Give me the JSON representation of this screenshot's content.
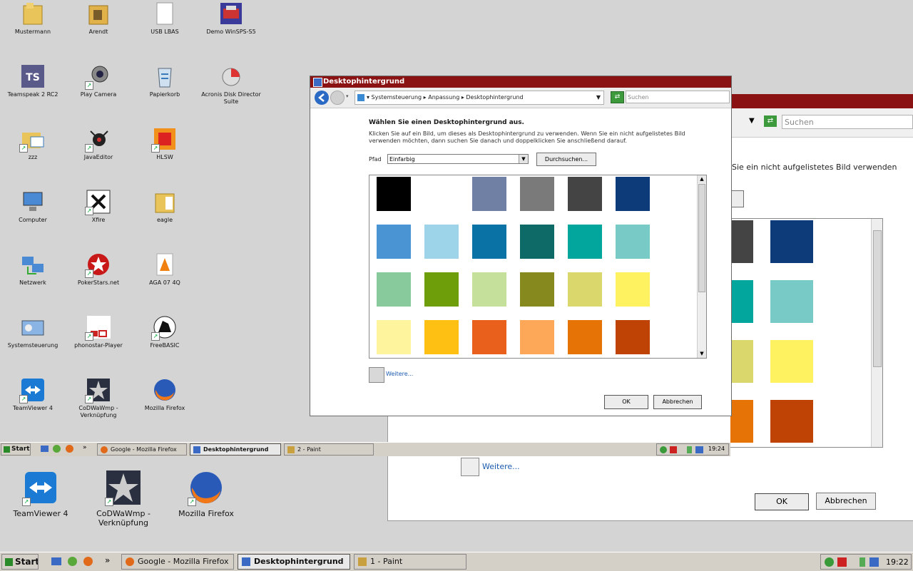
{
  "desktop_small": {
    "icons": [
      {
        "label": "Mustermann"
      },
      {
        "label": "Arendt"
      },
      {
        "label": "USB LBAS"
      },
      {
        "label": "Demo WinSPS-S5"
      },
      {
        "label": "Teamspeak 2 RC2"
      },
      {
        "label": "Play Camera"
      },
      {
        "label": "Papierkorb"
      },
      {
        "label": "Acronis Disk Director Suite"
      },
      {
        "label": "zzz"
      },
      {
        "label": "JavaEditor"
      },
      {
        "label": "HLSW"
      },
      {
        "label": "Computer"
      },
      {
        "label": "Xfire"
      },
      {
        "label": "eagle"
      },
      {
        "label": "Netzwerk"
      },
      {
        "label": "PokerStars.net"
      },
      {
        "label": "AGA 07 4Q"
      },
      {
        "label": "Systemsteuerung"
      },
      {
        "label": "phonostar-Player"
      },
      {
        "label": "FreeBASIC"
      },
      {
        "label": "TeamViewer 4"
      },
      {
        "label": "CoDWaWmp - Verknüpfung"
      },
      {
        "label": "Mozilla Firefox"
      }
    ]
  },
  "desktop_large": {
    "icons": [
      {
        "label": "TeamViewer 4"
      },
      {
        "label": "CoDWaWmp - Verknüpfung"
      },
      {
        "label": "Mozilla Firefox"
      }
    ]
  },
  "window": {
    "title": "Desktophintergrund",
    "breadcrumb": "▾ Systemsteuerung ▸ Anpassung ▸ Desktophintergrund",
    "search_placeholder": "Suchen",
    "heading": "Wählen Sie einen Desktophintergrund aus.",
    "description": "Klicken Sie auf ein Bild, um dieses als Desktophintergrund zu verwenden. Wenn Sie ein nicht aufgelistetes Bild verwenden möchten, dann suchen Sie danach und doppelklicken Sie anschließend darauf.",
    "path_label": "Pfad",
    "path_value": "Einfarbig",
    "browse_label": "Durchsuchen...",
    "more_label": "Weitere...",
    "ok_label": "OK",
    "cancel_label": "Abbrechen",
    "swatches": [
      "#000000",
      "#ffffff",
      "#7080a4",
      "#7a7a7a",
      "#444444",
      "#0d3a78",
      "#4a94d4",
      "#9ed4ea",
      "#0a72a4",
      "#0d6a66",
      "#02a69c",
      "#78cac6",
      "#88ca9c",
      "#6e9e0a",
      "#c4e09a",
      "#868a1e",
      "#dad86c",
      "#fef260",
      "#fef49e",
      "#fec012",
      "#e9601c",
      "#fca858",
      "#e57306",
      "#c04306"
    ]
  },
  "bg_window": {
    "search_placeholder": "Suchen",
    "description_fragment": "Sie ein nicht aufgelistetes Bild verwenden",
    "more_label": "Weitere...",
    "ok_label": "OK",
    "cancel_label": "Abbrechen",
    "swatches": [
      "#444444",
      "#0d3a78",
      "#02a69c",
      "#78cac6",
      "#dad86c",
      "#fef260",
      "#e57306",
      "#c04306"
    ]
  },
  "taskbar_small": {
    "start_label": "Start",
    "more": "»",
    "items": [
      "Google - Mozilla Firefox",
      "Desktophintergrund",
      "2 - Paint"
    ],
    "clock": "19:24"
  },
  "taskbar_large": {
    "start_label": "Start",
    "more": "»",
    "items": [
      "Google - Mozilla Firefox",
      "Desktophintergrund",
      "1 - Paint"
    ],
    "clock": "19:22"
  }
}
